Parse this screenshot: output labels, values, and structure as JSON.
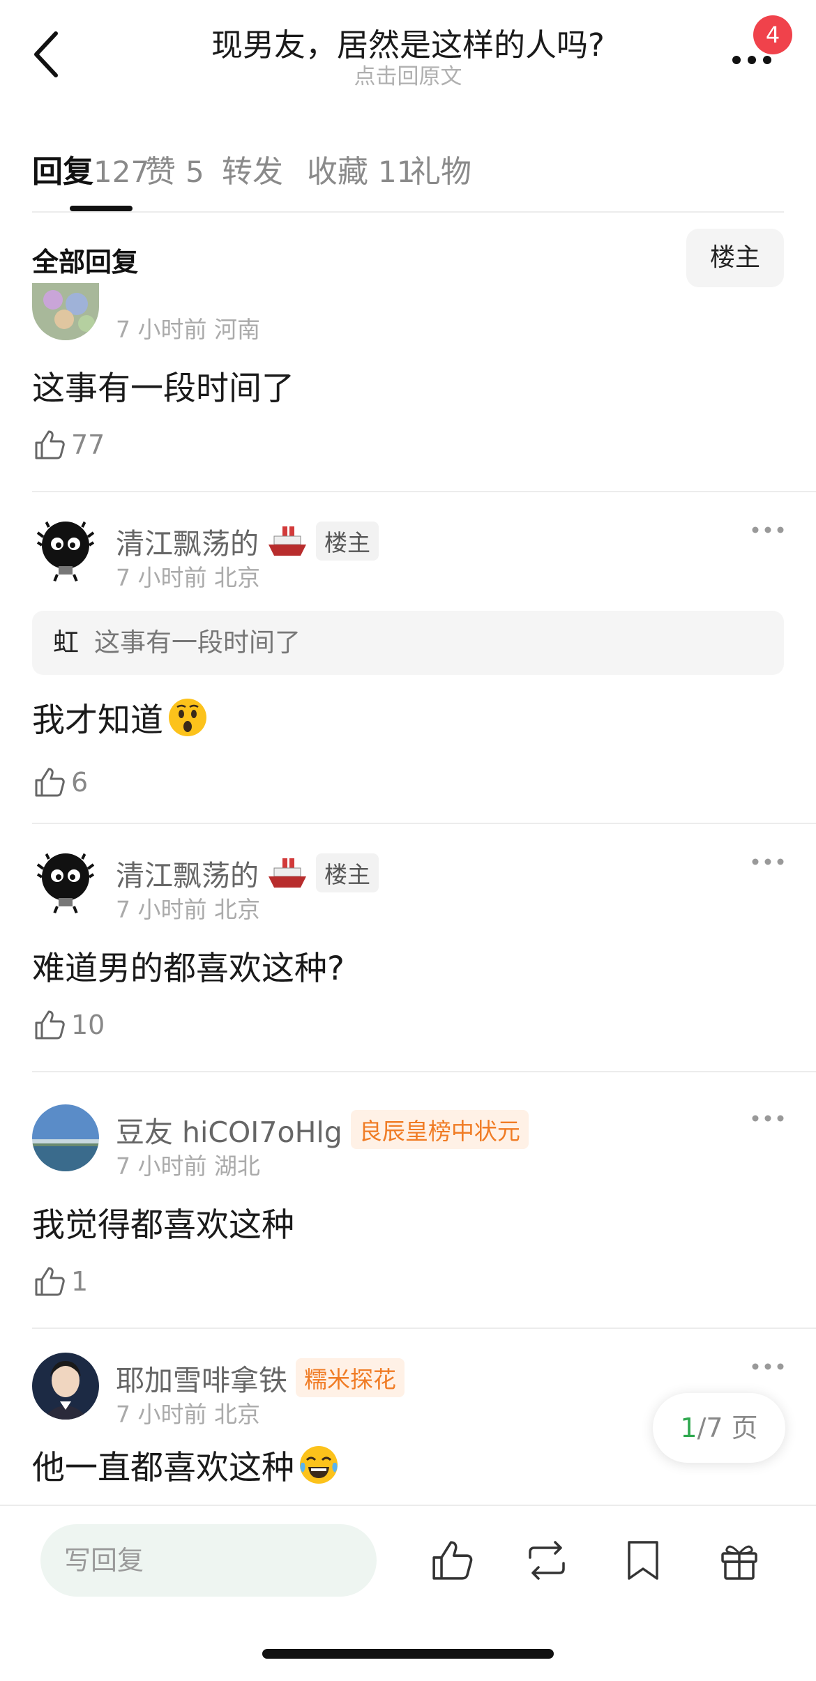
{
  "header": {
    "title": "现男友，居然是这样的人吗?",
    "subtitle": "点击回原文",
    "badge_count": "4"
  },
  "tabs": [
    {
      "label": "回复",
      "count": "127",
      "active": true
    },
    {
      "label": "赞",
      "count": "5"
    },
    {
      "label": "转发",
      "count": ""
    },
    {
      "label": "收藏",
      "count": "11"
    },
    {
      "label": "礼物",
      "count": ""
    }
  ],
  "section": {
    "title": "全部回复",
    "filter_label": "楼主"
  },
  "comments": [
    {
      "meta": "7 小时前 河南",
      "content": "这事有一段时间了",
      "likes": "77"
    },
    {
      "username": "清江飘荡的",
      "tag": "楼主",
      "meta": "7 小时前 北京",
      "quote_author": "虹",
      "quote_text": "这事有一段时间了",
      "content": "我才知道",
      "emoji": "surprised-emoji",
      "likes": "6"
    },
    {
      "username": "清江飘荡的",
      "tag": "楼主",
      "meta": "7 小时前 北京",
      "content": "难道男的都喜欢这种?",
      "likes": "10"
    },
    {
      "username": "豆友 hiCOI7oHlg",
      "tag": "良辰皇榜中状元",
      "meta": "7 小时前 湖北",
      "content": "我觉得都喜欢这种",
      "likes": "1"
    },
    {
      "username": "耶加雪啡拿铁",
      "tag": "糯米探花",
      "meta": "7 小时前 北京",
      "content": "他一直都喜欢这种",
      "emoji": "tears-of-joy-emoji"
    }
  ],
  "pager": {
    "current": "1",
    "total_text": "/7 页"
  },
  "bottom_bar": {
    "reply_placeholder": "写回复",
    "icons": [
      "like-icon",
      "repost-icon",
      "bookmark-icon",
      "gift-icon"
    ]
  },
  "colors": {
    "badge": "#f0424b",
    "honor_tag": "#f07c25",
    "pager_current": "#2fa84f",
    "input_bg": "#eef5f1"
  }
}
